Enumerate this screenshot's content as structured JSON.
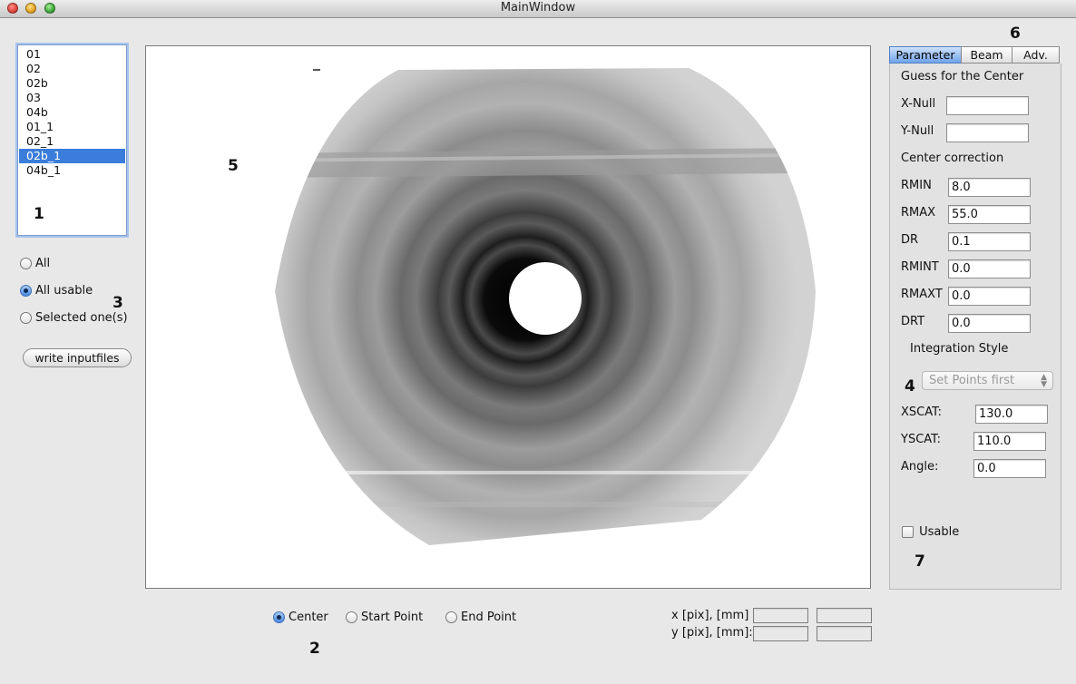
{
  "window": {
    "title": "MainWindow"
  },
  "file_list": {
    "items": [
      "01",
      "02",
      "02b",
      "03",
      "04b",
      "01_1",
      "02_1",
      "02b_1",
      "04b_1"
    ],
    "selected_index": 7
  },
  "callouts": [
    "1",
    "2",
    "3",
    "4",
    "5",
    "6",
    "7"
  ],
  "selection_mode": {
    "options": [
      "All",
      "All usable",
      "Selected one(s)"
    ],
    "selected": "All usable"
  },
  "write_button_label": "write inputfiles",
  "point_mode": {
    "options": [
      "Center",
      "Start Point",
      "End Point"
    ],
    "selected": "Center"
  },
  "readout": {
    "x_label": "x [pix], [mm]",
    "y_label": "y [pix], [mm]:",
    "x_pix": "",
    "x_mm": "",
    "y_pix": "",
    "y_mm": ""
  },
  "tabs": [
    "Parameter",
    "Beam",
    "Adv."
  ],
  "active_tab": "Parameter",
  "parameters": {
    "guess_heading": "Guess for the Center",
    "x_null_label": "X-Null",
    "x_null_value": "",
    "y_null_label": "Y-Null",
    "y_null_value": "",
    "center_heading": "Center correction",
    "rmin_label": "RMIN",
    "rmin_value": "8.0",
    "rmax_label": "RMAX",
    "rmax_value": "55.0",
    "dr_label": "DR",
    "dr_value": "0.1",
    "rmint_label": "RMINT",
    "rmint_value": "0.0",
    "rmaxt_label": "RMAXT",
    "rmaxt_value": "0.0",
    "drt_label": "DRT",
    "drt_value": "0.0",
    "integration_heading": "Integration Style",
    "integration_style": "Set Points first",
    "xscat_label": "XSCAT:",
    "xscat_value": "130.0",
    "yscat_label": "YSCAT:",
    "yscat_value": "110.0",
    "angle_label": "Angle:",
    "angle_value": "0.0",
    "usable_label": "Usable",
    "usable_checked": false
  },
  "icons": {
    "close": "close-icon",
    "minimize": "minimize-icon",
    "zoom": "zoom-icon",
    "select_arrows": "updown-arrows-icon"
  }
}
